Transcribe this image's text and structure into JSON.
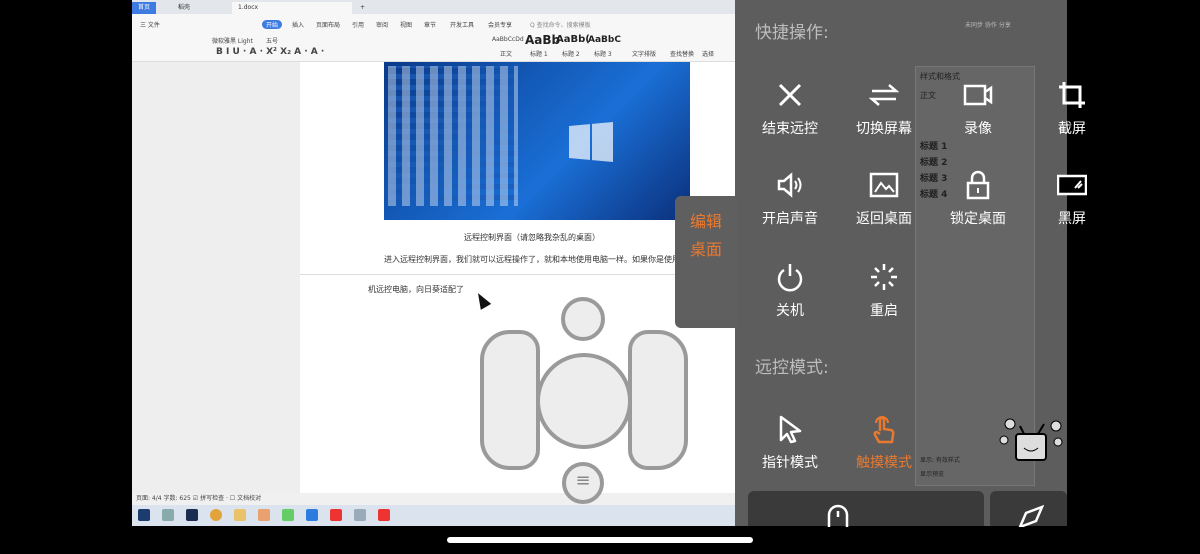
{
  "word": {
    "tabs": [
      "首页",
      "稻壳",
      "1.docx"
    ],
    "menu": [
      "三 文件",
      "开始",
      "插入",
      "页面布局",
      "引用",
      "审阅",
      "视图",
      "章节",
      "开发工具",
      "会员专享",
      "Q 查找命令、搜索模板"
    ],
    "font_name": "微软雅黑 Light",
    "font_size": "五号",
    "styles": [
      "AaBbCcDd",
      "AaBb",
      "AaBb(",
      "AaBbC"
    ],
    "style_labels": [
      "正文",
      "标题 1",
      "标题 2",
      "标题 3"
    ],
    "ribbon_right": [
      "文字排版",
      "查找替换",
      "选择"
    ],
    "top_right": [
      "未同步",
      "协作",
      "分享"
    ],
    "caption": "远程控制界面（请忽略我杂乱的桌面）",
    "paragraph": "进入远程控制界面，我们就可以远程操作了，就和本地使用电脑一样。如果你是使用手",
    "paragraph2": "机远控电脑，向日葵适配了",
    "status": "页面: 4/4   字数: 625  ☑ 拼写检查 ·  ☐ 文档校对",
    "side_pane": {
      "title": "样式和格式",
      "current": "正文",
      "headings": [
        "标题 1",
        "标题 2",
        "标题 3",
        "标题 4"
      ],
      "footer": "显示: 有效样式",
      "show_preview": "显示预览"
    }
  },
  "edit_desktop": [
    "编辑",
    "桌面"
  ],
  "quick_ops": {
    "title": "快捷操作:",
    "items": [
      {
        "label": "结束远控",
        "icon": "close-icon"
      },
      {
        "label": "切换屏幕",
        "icon": "switch-screen-icon"
      },
      {
        "label": "录像",
        "icon": "video-camera-icon"
      },
      {
        "label": "截屏",
        "icon": "crop-icon"
      },
      {
        "label": "开启声音",
        "icon": "speaker-icon"
      },
      {
        "label": "返回桌面",
        "icon": "desktop-picture-icon"
      },
      {
        "label": "锁定桌面",
        "icon": "lock-icon"
      },
      {
        "label": "黑屏",
        "icon": "black-screen-icon"
      },
      {
        "label": "关机",
        "icon": "power-icon"
      },
      {
        "label": "重启",
        "icon": "restart-icon"
      }
    ]
  },
  "modes": {
    "title": "远控模式:",
    "items": [
      {
        "label": "指针模式",
        "active": false
      },
      {
        "label": "触摸模式",
        "active": true
      }
    ]
  },
  "colors": {
    "accent": "#e8792f",
    "overlay": "#5d5d5d"
  }
}
